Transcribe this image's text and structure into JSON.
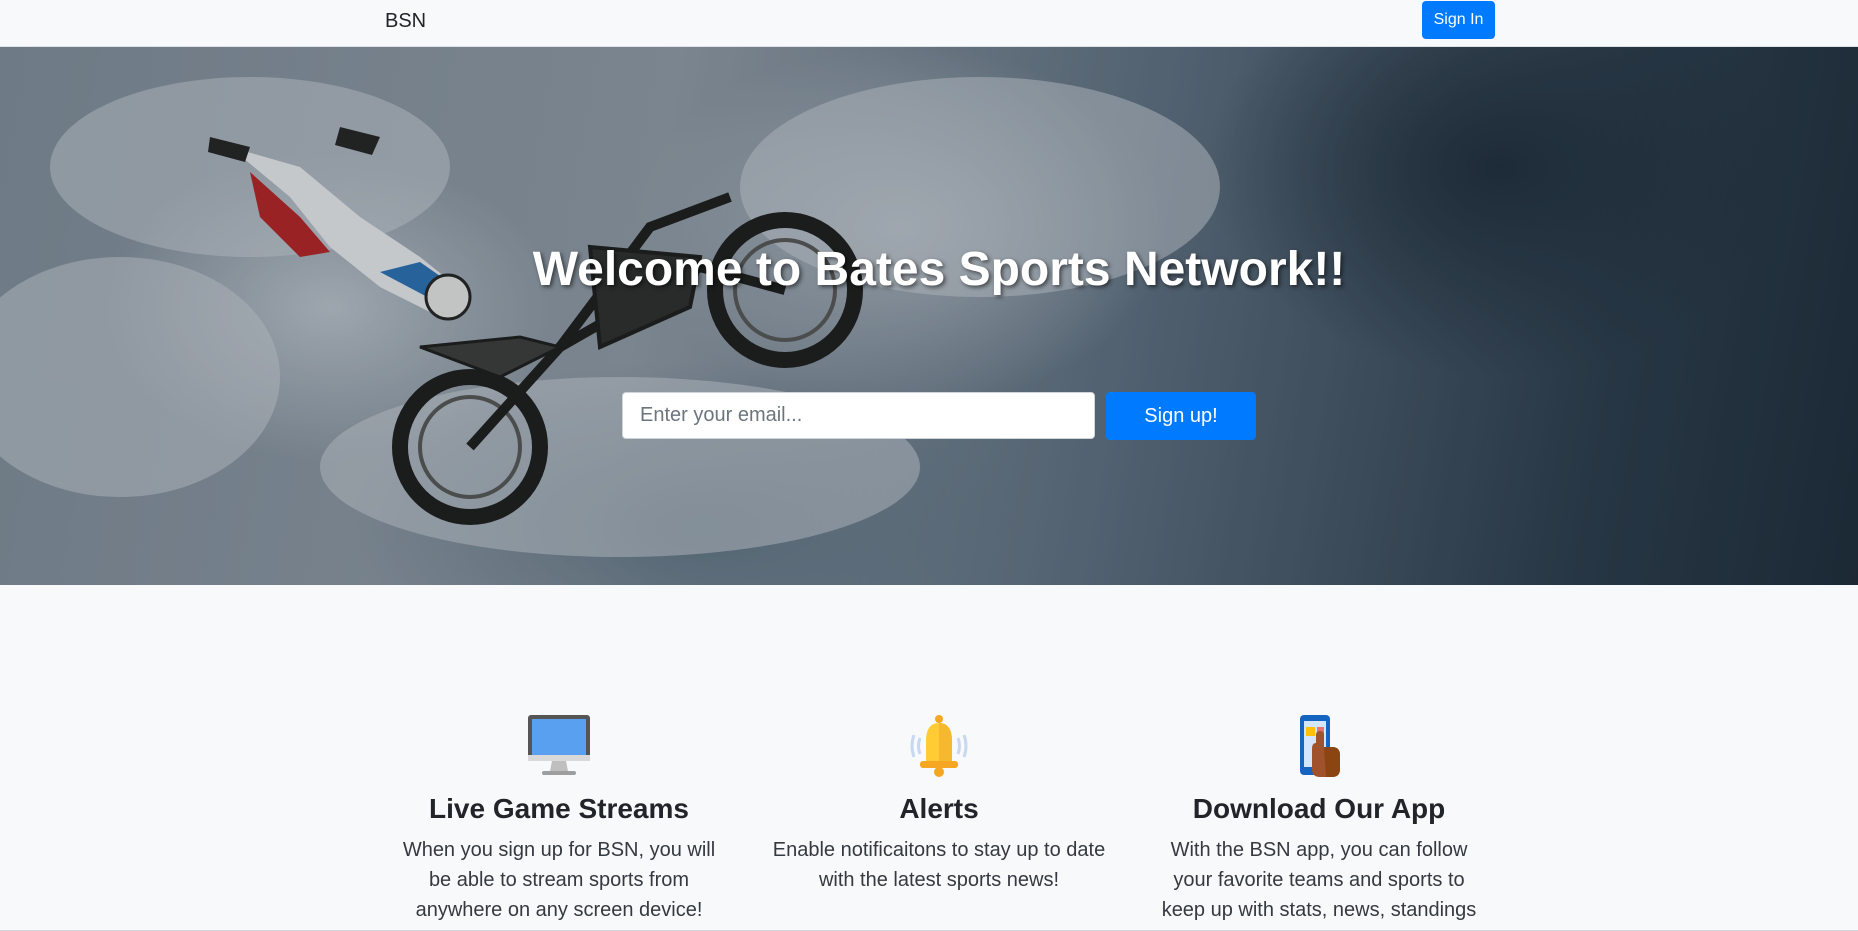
{
  "navbar": {
    "brand": "BSN",
    "signin_label": "Sign In"
  },
  "hero": {
    "title": "Welcome to Bates Sports Network!!",
    "email_placeholder": "Enter your email...",
    "signup_label": "Sign up!"
  },
  "features": [
    {
      "icon": "desktop-monitor-icon",
      "title": "Live Game Streams",
      "text": "When you sign up for BSN, you will be able to stream sports from anywhere on any screen device!"
    },
    {
      "icon": "bell-icon",
      "title": "Alerts",
      "text": "Enable notificaitons to stay up to date with the latest sports news!"
    },
    {
      "icon": "phone-app-icon",
      "title": "Download Our App",
      "text": "With the BSN app, you can follow your favorite teams and sports to keep up with stats, news, standings"
    }
  ],
  "colors": {
    "primary": "#007bff",
    "background": "#f8f9fa",
    "text": "#212529"
  }
}
